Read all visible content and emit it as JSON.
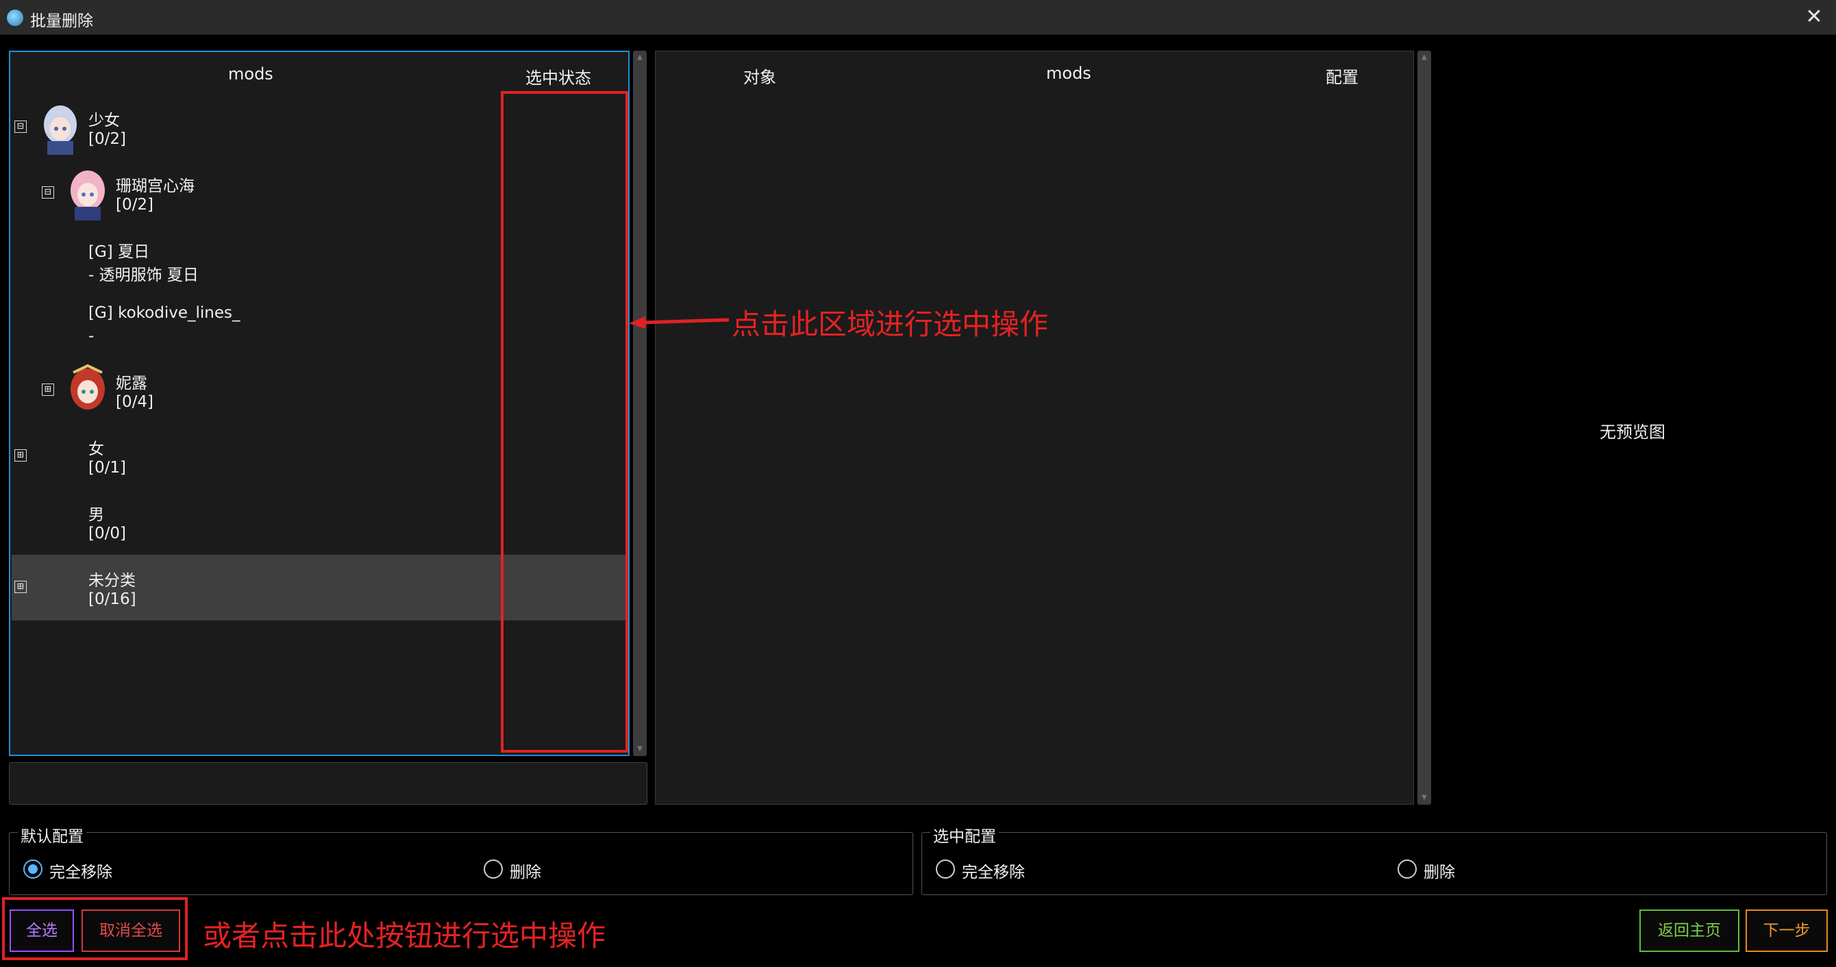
{
  "window": {
    "title": "批量删除",
    "close_glyph": "✕"
  },
  "tree": {
    "headers": {
      "mods": "mods",
      "status": "选中状态"
    },
    "rows": [
      {
        "name": "少女",
        "count": "[0/2]",
        "expander": "⊟",
        "icon": "girl-avatar-icon"
      },
      {
        "name": "珊瑚宫心海",
        "count": "[0/2]",
        "expander": "⊟",
        "icon": "kokomi-avatar-icon"
      },
      {
        "name": "[G] 夏日",
        "count": "- 透明服饰 夏日"
      },
      {
        "name": "[G] kokodive_lines_",
        "count": "-"
      },
      {
        "name": "妮露",
        "count": "[0/4]",
        "expander": "⊞",
        "icon": "nilou-avatar-icon"
      },
      {
        "name": "女",
        "count": "[0/1]",
        "expander": "⊞"
      },
      {
        "name": "男",
        "count": "[0/0]"
      },
      {
        "name": "未分类",
        "count": "[0/16]",
        "expander": "⊞"
      }
    ]
  },
  "target_table": {
    "headers": {
      "target": "对象",
      "mods": "mods",
      "config": "配置"
    }
  },
  "preview": {
    "empty_text": "无预览图"
  },
  "default_config": {
    "title": "默认配置",
    "options": [
      {
        "label": "完全移除",
        "checked": true
      },
      {
        "label": "删除",
        "checked": false
      }
    ]
  },
  "selected_config": {
    "title": "选中配置",
    "options": [
      {
        "label": "完全移除",
        "checked": false
      },
      {
        "label": "删除",
        "checked": false
      }
    ]
  },
  "buttons": {
    "select_all": "全选",
    "deselect_all": "取消全选",
    "back_home": "返回主页",
    "next": "下一步"
  },
  "colors": {
    "accent_blue": "#1e90d8",
    "select_all": "#9b4dff",
    "deselect_all": "#d43a3a",
    "back_home": "#5fbf3a",
    "next": "#e88a1a",
    "annotation_red": "#e12222"
  },
  "annotations": {
    "click_area": "点击此区域进行选中操作",
    "click_buttons": "或者点击此处按钮进行选中操作"
  }
}
